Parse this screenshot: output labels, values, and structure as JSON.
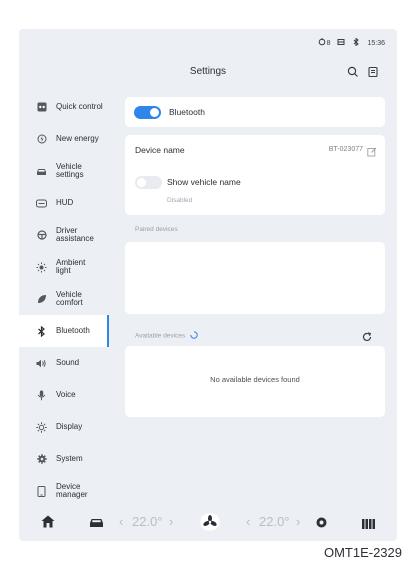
{
  "status": {
    "signal": "8",
    "time": "15:36"
  },
  "header": {
    "title": "Settings",
    "search_icon": "search-icon",
    "notes_icon": "notes-icon"
  },
  "sidebar": {
    "items": [
      {
        "label": "Quick control",
        "icon": "quick-control-icon"
      },
      {
        "label": "New energy",
        "icon": "new-energy-icon"
      },
      {
        "label": "Vehicle\nsettings",
        "icon": "car-icon"
      },
      {
        "label": "HUD",
        "icon": "hud-icon"
      },
      {
        "label": "Driver\nassistance",
        "icon": "steering-wheel-icon"
      },
      {
        "label": "Ambient\nlight",
        "icon": "ambient-light-icon"
      },
      {
        "label": "Vehicle\ncomfort",
        "icon": "leaf-icon"
      },
      {
        "label": "Bluetooth",
        "icon": "bluetooth-icon",
        "active": true
      },
      {
        "label": "Sound",
        "icon": "sound-icon"
      },
      {
        "label": "Voice",
        "icon": "microphone-icon"
      },
      {
        "label": "Display",
        "icon": "brightness-icon"
      },
      {
        "label": "System",
        "icon": "gear-icon"
      },
      {
        "label": "Device\nmanager",
        "icon": "device-icon"
      }
    ]
  },
  "bluetooth": {
    "label": "Bluetooth",
    "enabled": true
  },
  "device": {
    "name_label": "Device name",
    "name_value": "BT-023077",
    "show_name_label": "Show vehicle name",
    "show_name_status": "Disabled",
    "show_name_enabled": false
  },
  "paired": {
    "heading": "Paired devices"
  },
  "available": {
    "heading": "Available devices",
    "empty_text": "No available devices found"
  },
  "climate": {
    "left_temp": "22.0°",
    "right_temp": "22.0°"
  },
  "caption": "OMT1E-2329"
}
